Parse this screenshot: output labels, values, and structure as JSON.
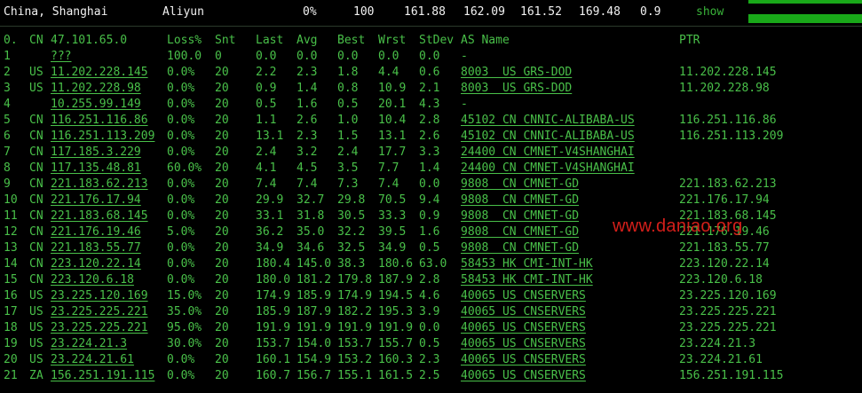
{
  "summary": {
    "location": "China, Shanghai",
    "isp": "Aliyun",
    "loss": "0%",
    "snt": "100",
    "last": "161.88",
    "avg": "162.09",
    "best": "161.52",
    "wrst": "169.48",
    "stdev": "0.9",
    "show": "show"
  },
  "header": {
    "num": "0.",
    "cc": "CN",
    "ip": "47.101.65.0",
    "loss": "Loss%",
    "snt": "Snt",
    "last": "Last",
    "avg": "Avg",
    "best": "Best",
    "wrst": "Wrst",
    "stdev": "StDev",
    "as": "AS Name",
    "ptr": "PTR"
  },
  "rows": [
    {
      "num": "1",
      "cc": "",
      "ip": "???",
      "loss": "100.0",
      "snt": "0",
      "last": "0.0",
      "avg": "0.0",
      "best": "0.0",
      "wrst": "0.0",
      "stdev": "0.0",
      "as": "-",
      "ptr": ""
    },
    {
      "num": "2",
      "cc": "US",
      "ip": "11.202.228.145",
      "loss": "0.0%",
      "snt": "20",
      "last": "2.2",
      "avg": "2.3",
      "best": "1.8",
      "wrst": "4.4",
      "stdev": "0.6",
      "as": "8003  US GRS-DOD",
      "ptr": "11.202.228.145"
    },
    {
      "num": "3",
      "cc": "US",
      "ip": "11.202.228.98",
      "loss": "0.0%",
      "snt": "20",
      "last": "0.9",
      "avg": "1.4",
      "best": "0.8",
      "wrst": "10.9",
      "stdev": "2.1",
      "as": "8003  US GRS-DOD",
      "ptr": "11.202.228.98"
    },
    {
      "num": "4",
      "cc": "",
      "ip": "10.255.99.149",
      "loss": "0.0%",
      "snt": "20",
      "last": "0.5",
      "avg": "1.6",
      "best": "0.5",
      "wrst": "20.1",
      "stdev": "4.3",
      "as": "-",
      "ptr": ""
    },
    {
      "num": "5",
      "cc": "CN",
      "ip": "116.251.116.86",
      "loss": "0.0%",
      "snt": "20",
      "last": "1.1",
      "avg": "2.6",
      "best": "1.0",
      "wrst": "10.4",
      "stdev": "2.8",
      "as": "45102 CN CNNIC-ALIBABA-US",
      "ptr": "116.251.116.86"
    },
    {
      "num": "6",
      "cc": "CN",
      "ip": "116.251.113.209",
      "loss": "0.0%",
      "snt": "20",
      "last": "13.1",
      "avg": "2.3",
      "best": "1.5",
      "wrst": "13.1",
      "stdev": "2.6",
      "as": "45102 CN CNNIC-ALIBABA-US",
      "ptr": "116.251.113.209"
    },
    {
      "num": "7",
      "cc": "CN",
      "ip": "117.185.3.229",
      "loss": "0.0%",
      "snt": "20",
      "last": "2.4",
      "avg": "3.2",
      "best": "2.4",
      "wrst": "17.7",
      "stdev": "3.3",
      "as": "24400 CN CMNET-V4SHANGHAI",
      "ptr": ""
    },
    {
      "num": "8",
      "cc": "CN",
      "ip": "117.135.48.81",
      "loss": "60.0%",
      "snt": "20",
      "last": "4.1",
      "avg": "4.5",
      "best": "3.5",
      "wrst": "7.7",
      "stdev": "1.4",
      "as": "24400 CN CMNET-V4SHANGHAI",
      "ptr": ""
    },
    {
      "num": "9",
      "cc": "CN",
      "ip": "221.183.62.213",
      "loss": "0.0%",
      "snt": "20",
      "last": "7.4",
      "avg": "7.4",
      "best": "7.3",
      "wrst": "7.4",
      "stdev": "0.0",
      "as": "9808  CN CMNET-GD",
      "ptr": "221.183.62.213"
    },
    {
      "num": "10",
      "cc": "CN",
      "ip": "221.176.17.94",
      "loss": "0.0%",
      "snt": "20",
      "last": "29.9",
      "avg": "32.7",
      "best": "29.8",
      "wrst": "70.5",
      "stdev": "9.4",
      "as": "9808  CN CMNET-GD",
      "ptr": "221.176.17.94"
    },
    {
      "num": "11",
      "cc": "CN",
      "ip": "221.183.68.145",
      "loss": "0.0%",
      "snt": "20",
      "last": "33.1",
      "avg": "31.8",
      "best": "30.5",
      "wrst": "33.3",
      "stdev": "0.9",
      "as": "9808  CN CMNET-GD",
      "ptr": "221.183.68.145"
    },
    {
      "num": "12",
      "cc": "CN",
      "ip": "221.176.19.46",
      "loss": "5.0%",
      "snt": "20",
      "last": "36.2",
      "avg": "35.0",
      "best": "32.2",
      "wrst": "39.5",
      "stdev": "1.6",
      "as": "9808  CN CMNET-GD",
      "ptr": "221.176.19.46"
    },
    {
      "num": "13",
      "cc": "CN",
      "ip": "221.183.55.77",
      "loss": "0.0%",
      "snt": "20",
      "last": "34.9",
      "avg": "34.6",
      "best": "32.5",
      "wrst": "34.9",
      "stdev": "0.5",
      "as": "9808  CN CMNET-GD",
      "ptr": "221.183.55.77"
    },
    {
      "num": "14",
      "cc": "CN",
      "ip": "223.120.22.14",
      "loss": "0.0%",
      "snt": "20",
      "last": "180.4",
      "avg": "145.0",
      "best": "38.3",
      "wrst": "180.6",
      "stdev": "63.0",
      "as": "58453 HK CMI-INT-HK",
      "ptr": "223.120.22.14"
    },
    {
      "num": "15",
      "cc": "CN",
      "ip": "223.120.6.18",
      "loss": "0.0%",
      "snt": "20",
      "last": "180.0",
      "avg": "181.2",
      "best": "179.8",
      "wrst": "187.9",
      "stdev": "2.8",
      "as": "58453 HK CMI-INT-HK",
      "ptr": "223.120.6.18"
    },
    {
      "num": "16",
      "cc": "US",
      "ip": "23.225.120.169",
      "loss": "15.0%",
      "snt": "20",
      "last": "174.9",
      "avg": "185.9",
      "best": "174.9",
      "wrst": "194.5",
      "stdev": "4.6",
      "as": "40065 US CNSERVERS",
      "ptr": "23.225.120.169"
    },
    {
      "num": "17",
      "cc": "US",
      "ip": "23.225.225.221",
      "loss": "35.0%",
      "snt": "20",
      "last": "185.9",
      "avg": "187.9",
      "best": "182.2",
      "wrst": "195.3",
      "stdev": "3.9",
      "as": "40065 US CNSERVERS",
      "ptr": "23.225.225.221"
    },
    {
      "num": "18",
      "cc": "US",
      "ip": "23.225.225.221",
      "loss": "95.0%",
      "snt": "20",
      "last": "191.9",
      "avg": "191.9",
      "best": "191.9",
      "wrst": "191.9",
      "stdev": "0.0",
      "as": "40065 US CNSERVERS",
      "ptr": "23.225.225.221"
    },
    {
      "num": "19",
      "cc": "US",
      "ip": "23.224.21.3",
      "loss": "30.0%",
      "snt": "20",
      "last": "153.7",
      "avg": "154.0",
      "best": "153.7",
      "wrst": "155.7",
      "stdev": "0.5",
      "as": "40065 US CNSERVERS",
      "ptr": "23.224.21.3"
    },
    {
      "num": "20",
      "cc": "US",
      "ip": "23.224.21.61",
      "loss": "0.0%",
      "snt": "20",
      "last": "160.1",
      "avg": "154.9",
      "best": "153.2",
      "wrst": "160.3",
      "stdev": "2.3",
      "as": "40065 US CNSERVERS",
      "ptr": "23.224.21.61"
    },
    {
      "num": "21",
      "cc": "ZA",
      "ip": "156.251.191.115",
      "loss": "0.0%",
      "snt": "20",
      "last": "160.7",
      "avg": "156.7",
      "best": "155.1",
      "wrst": "161.5",
      "stdev": "2.5",
      "as": "40065 US CNSERVERS",
      "ptr": "156.251.191.115"
    }
  ],
  "watermark": "www.daniao.org",
  "colors": {
    "background": "#000000",
    "text_green": "#49c049",
    "summary_text": "#f2f2f2",
    "bar_green": "#19a819",
    "watermark_red": "#e0211c"
  }
}
